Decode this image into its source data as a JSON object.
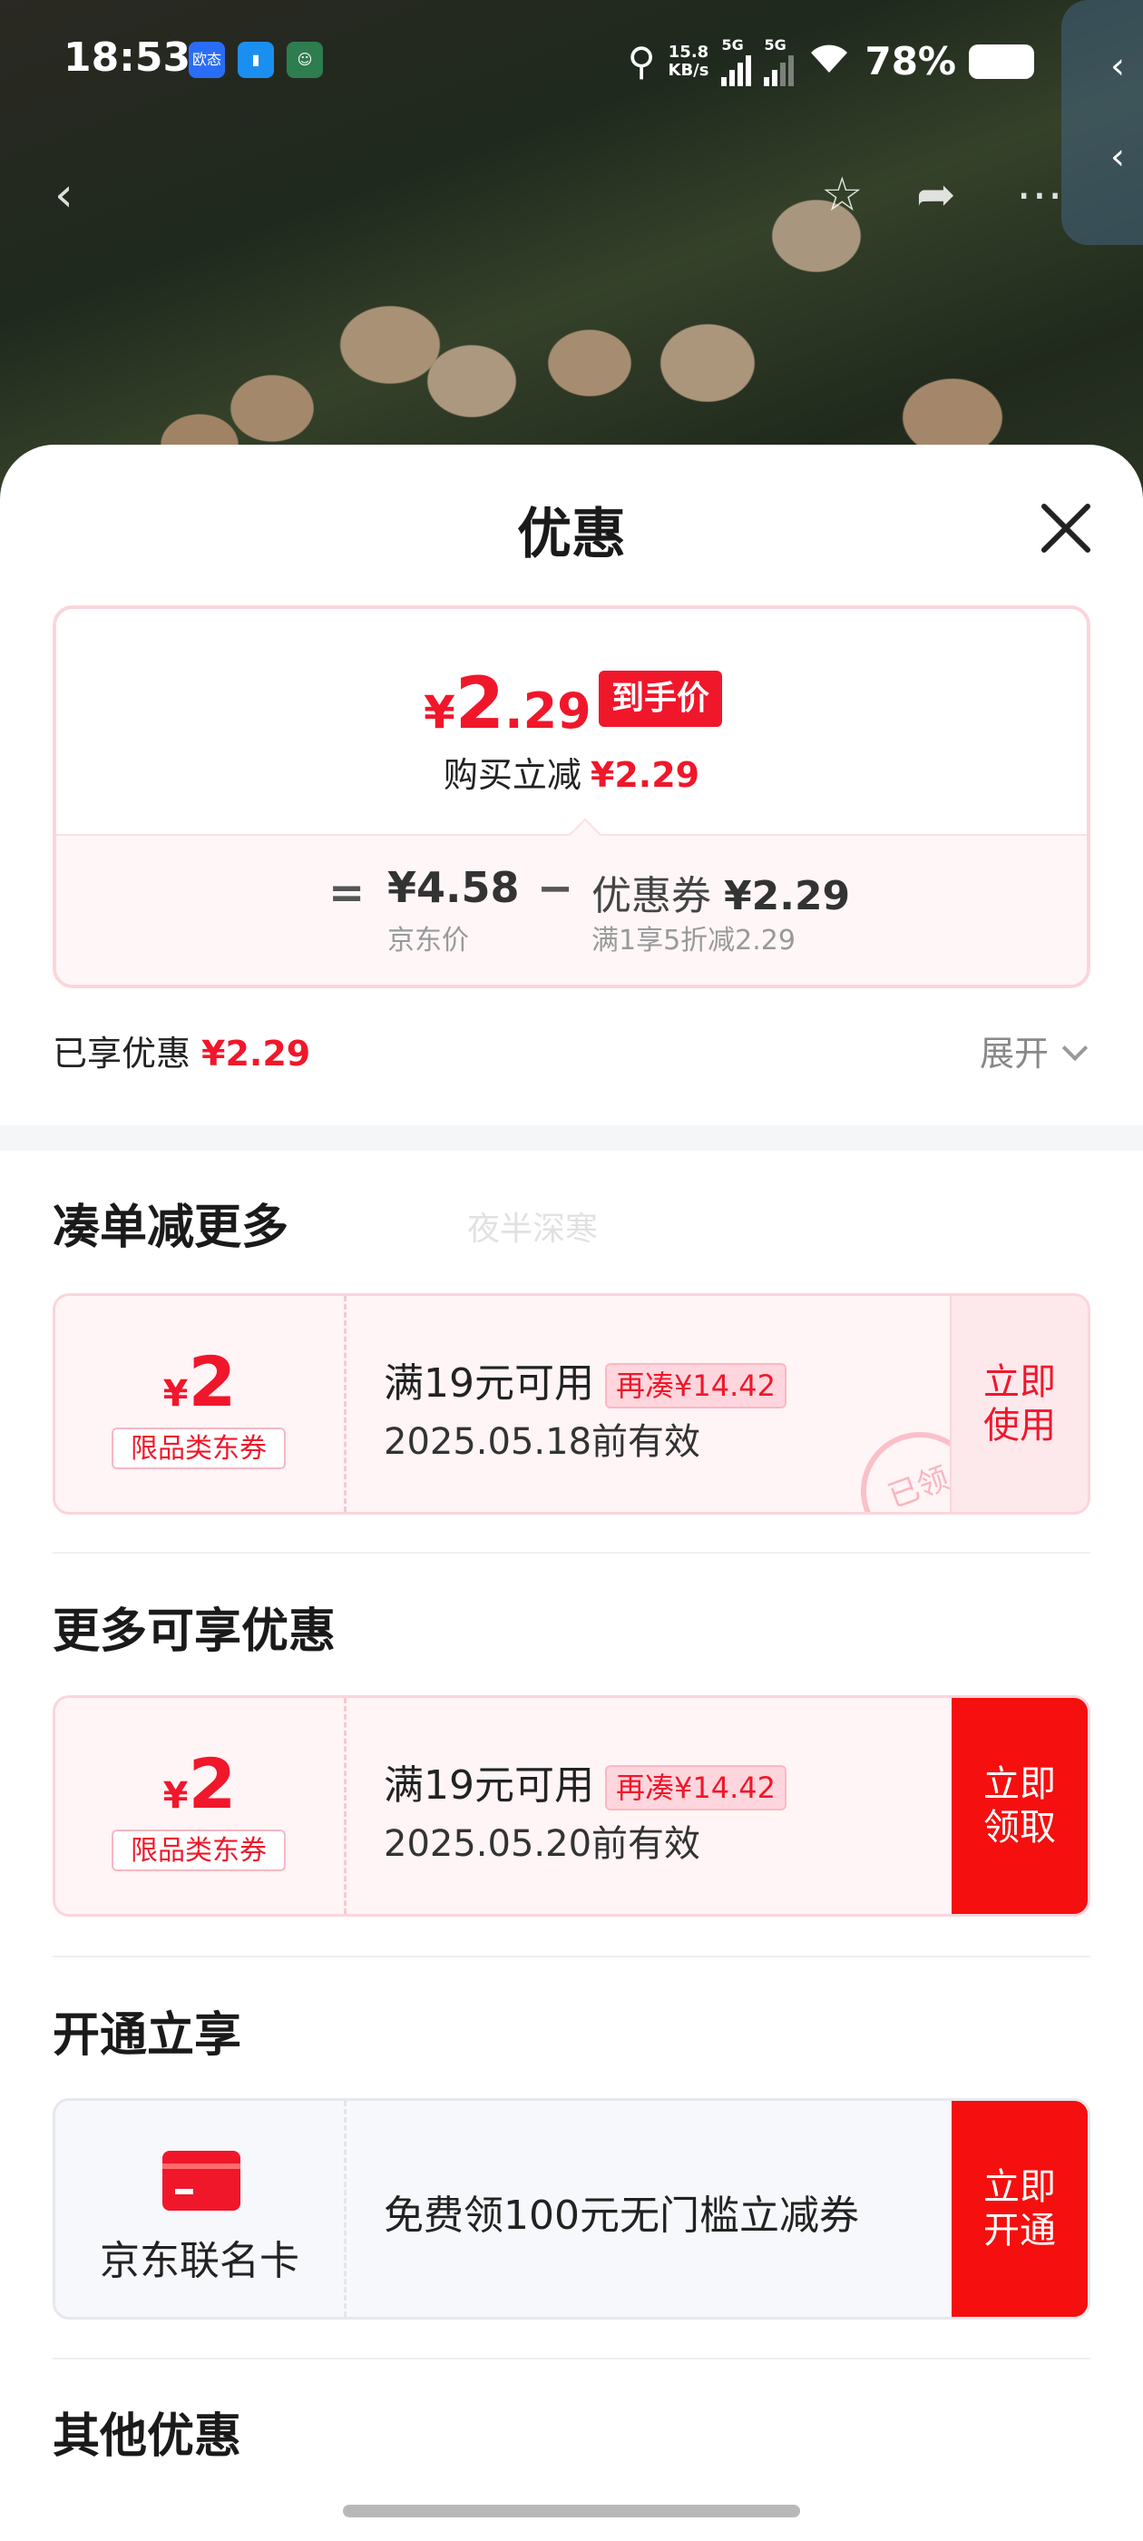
{
  "status_bar": {
    "time": "18:53",
    "net_speed_value": "15.8",
    "net_speed_unit": "KB/s",
    "sig1": "5G",
    "sig2": "5G",
    "battery": "78%",
    "app_icon_1": "欧态"
  },
  "sheet": {
    "title": "优惠"
  },
  "price_summary": {
    "currency": "¥",
    "price_int": "2",
    "price_dec": ".29",
    "badge": "到手价",
    "subtitle": "购买立减",
    "subtitle_amount": "¥2.29",
    "equals": "=",
    "jd_price": "¥4.58",
    "jd_price_label": "京东价",
    "minus": "−",
    "coupon_text": "优惠券",
    "coupon_amount": "¥2.29",
    "coupon_desc": "满1享5折减2.29"
  },
  "enjoyed": {
    "label": "已享优惠",
    "amount": "¥2.29",
    "expand": "展开"
  },
  "watermark": "夜半深寒",
  "sections": {
    "combine": {
      "title": "凑单减更多",
      "coupon": {
        "currency": "¥",
        "amount": "2",
        "tag": "限品类东券",
        "condition": "满19元可用",
        "condition_tag": "再凑¥14.42",
        "date": "2025.05.18前有效",
        "action_line1": "立即",
        "action_line2": "使用",
        "stamp": "已领"
      }
    },
    "more": {
      "title": "更多可享优惠",
      "coupon": {
        "currency": "¥",
        "amount": "2",
        "tag": "限品类东券",
        "condition": "满19元可用",
        "condition_tag": "再凑¥14.42",
        "date": "2025.05.20前有效",
        "action_line1": "立即",
        "action_line2": "领取"
      }
    },
    "open": {
      "title": "开通立享",
      "card": {
        "name": "京东联名卡",
        "desc": "免费领100元无门槛立减券",
        "action_line1": "立即",
        "action_line2": "开通"
      }
    },
    "other": {
      "title": "其他优惠"
    }
  },
  "colors": {
    "accent_red": "#f0172b",
    "button_red": "#f50f0f",
    "pink_border": "#fbd5db"
  }
}
